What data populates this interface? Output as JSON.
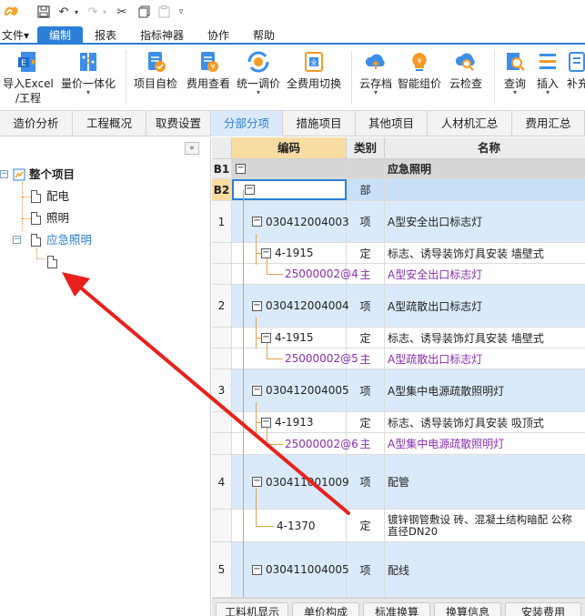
{
  "titlebar": {
    "quick_access": [
      "save-icon",
      "undo-icon",
      "redo-icon",
      "cut-icon",
      "copy-icon",
      "paste-icon",
      "more-icon"
    ]
  },
  "menu": {
    "items": [
      "文件▾",
      "编制",
      "报表",
      "指标神器",
      "协作",
      "帮助"
    ],
    "active": "编制"
  },
  "ribbon": {
    "buttons": [
      {
        "label": "导入Excel",
        "label2": "/工程",
        "caret": "▾"
      },
      {
        "label": "量价一体化",
        "label2": "",
        "caret": "▾"
      },
      {
        "label": "项目自检",
        "label2": "",
        "caret": ""
      },
      {
        "label": "费用查看",
        "label2": "",
        "caret": ""
      },
      {
        "label": "统一调价",
        "label2": "",
        "caret": "▾"
      },
      {
        "label": "全费用切换",
        "label2": "",
        "caret": ""
      },
      {
        "label": "云存档",
        "label2": "",
        "caret": "▾"
      },
      {
        "label": "智能组价",
        "label2": "",
        "caret": ""
      },
      {
        "label": "云检查",
        "label2": "",
        "caret": ""
      },
      {
        "label": "查询",
        "label2": "",
        "caret": "▾"
      },
      {
        "label": "插入",
        "label2": "",
        "caret": "▾"
      },
      {
        "label": "补充",
        "label2": "",
        "caret": ""
      }
    ],
    "colors": {
      "blue": "#2b7fd8",
      "orange": "#f59a23"
    }
  },
  "tabs": [
    "造价分析",
    "工程概况",
    "取费设置",
    "分部分项",
    "措施项目",
    "其他项目",
    "人材机汇总",
    "费用汇总"
  ],
  "tabs_active": "分部分项",
  "tree": {
    "collapse_label": "«",
    "root": "整个项目",
    "children": [
      "配电",
      "照明",
      "应急照明"
    ],
    "selected": "应急照明"
  },
  "grid": {
    "headers": {
      "code": "编码",
      "type": "类别",
      "name": "名称"
    },
    "rows": [
      {
        "idx": "B1",
        "code": "",
        "type": "",
        "name": "应急照明",
        "kind": "group"
      },
      {
        "idx": "B2",
        "code": "",
        "type": "部",
        "name": "",
        "kind": "section"
      },
      {
        "idx": "1",
        "code": "030412004003",
        "type": "项",
        "name": "A型安全出口标志灯",
        "kind": "item"
      },
      {
        "idx": "",
        "code": "4-1915",
        "type": "定",
        "name": "标志、诱导装饰灯具安装 墙壁式",
        "kind": "quota"
      },
      {
        "idx": "",
        "code": "25000002@4",
        "type": "主",
        "name": "A型安全出口标志灯",
        "kind": "main"
      },
      {
        "idx": "2",
        "code": "030412004004",
        "type": "项",
        "name": "A型疏散出口标志灯",
        "kind": "item"
      },
      {
        "idx": "",
        "code": "4-1915",
        "type": "定",
        "name": "标志、诱导装饰灯具安装 墙壁式",
        "kind": "quota"
      },
      {
        "idx": "",
        "code": "25000002@5",
        "type": "主",
        "name": "A型疏散出口标志灯",
        "kind": "main"
      },
      {
        "idx": "3",
        "code": "030412004005",
        "type": "项",
        "name": "A型集中电源疏散照明灯",
        "kind": "item"
      },
      {
        "idx": "",
        "code": "4-1913",
        "type": "定",
        "name": "标志、诱导装饰灯具安装 吸顶式",
        "kind": "quota"
      },
      {
        "idx": "",
        "code": "25000002@6",
        "type": "主",
        "name": "A型集中电源疏散照明灯",
        "kind": "main"
      },
      {
        "idx": "4",
        "code": "030411001009",
        "type": "项",
        "name": "配管",
        "kind": "item"
      },
      {
        "idx": "",
        "code": "4-1370",
        "type": "定",
        "name": "镀锌钢管敷设 砖、混凝土结构暗配 公称",
        "name2": "直径DN20",
        "kind": "quota2"
      },
      {
        "idx": "5",
        "code": "030411004005",
        "type": "项",
        "name": "配线",
        "kind": "item"
      }
    ]
  },
  "bottom_tabs": [
    "工料机显示",
    "单价构成",
    "标准换算",
    "换算信息",
    "安装费用"
  ]
}
